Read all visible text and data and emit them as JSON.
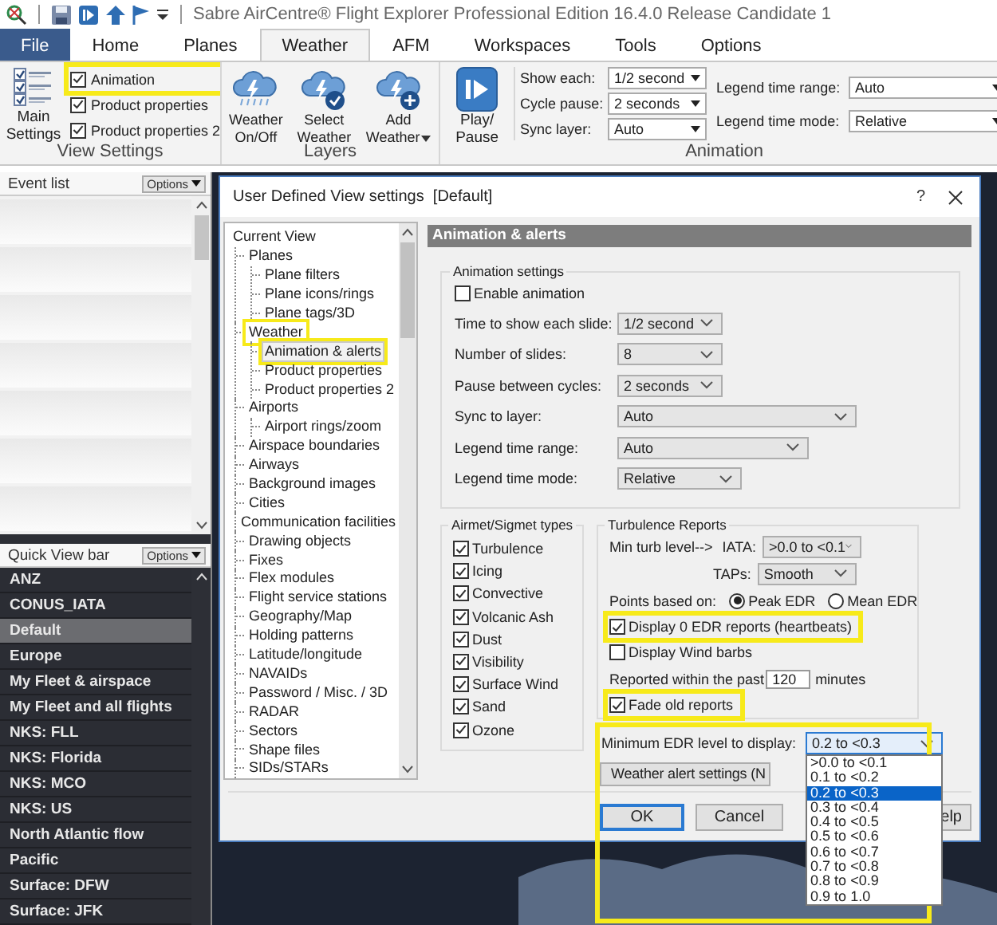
{
  "app": {
    "title": "Sabre AirCentre® Flight Explorer Professional Edition 16.4.0 Release Candidate 1"
  },
  "ribbon_tabs": [
    {
      "label": "File",
      "kind": "file",
      "selected": false
    },
    {
      "label": "Home",
      "kind": "tab",
      "selected": false
    },
    {
      "label": "Planes",
      "kind": "tab",
      "selected": false
    },
    {
      "label": "Weather",
      "kind": "tab",
      "selected": true
    },
    {
      "label": "AFM",
      "kind": "tab",
      "selected": false
    },
    {
      "label": "Workspaces",
      "kind": "tab",
      "selected": false
    },
    {
      "label": "Tools",
      "kind": "tab",
      "selected": false
    },
    {
      "label": "Options",
      "kind": "tab",
      "selected": false
    }
  ],
  "ribbon": {
    "view_settings": {
      "label": "View Settings",
      "main_button": "Main Settings",
      "checkboxes": [
        {
          "label": "Animation",
          "checked": true,
          "highlighted": true
        },
        {
          "label": "Product properties",
          "checked": true,
          "highlighted": false
        },
        {
          "label": "Product properties 2",
          "checked": true,
          "highlighted": false
        }
      ]
    },
    "layers": {
      "label": "Layers",
      "buttons": [
        {
          "label": "Weather On/Off",
          "kind": "toggle"
        },
        {
          "label": "Select Weather",
          "kind": "select"
        },
        {
          "label": "Add Weather",
          "kind": "add"
        }
      ]
    },
    "animation": {
      "label": "Animation",
      "play_button": "Play/ Pause",
      "fields": [
        {
          "label": "Show each:",
          "value": "1/2 second"
        },
        {
          "label": "Cycle pause:",
          "value": "2 seconds"
        },
        {
          "label": "Sync layer:",
          "value": "Auto"
        }
      ],
      "legend_fields": [
        {
          "label": "Legend time range:",
          "value": "Auto"
        },
        {
          "label": "Legend time mode:",
          "value": "Relative"
        }
      ]
    }
  },
  "event_list": {
    "title": "Event list",
    "options": "Options"
  },
  "quick_view": {
    "title": "Quick View bar",
    "options": "Options",
    "items": [
      {
        "label": "ANZ",
        "selected": false
      },
      {
        "label": "CONUS_IATA",
        "selected": false
      },
      {
        "label": "Default",
        "selected": true
      },
      {
        "label": "Europe",
        "selected": false
      },
      {
        "label": "My Fleet & airspace",
        "selected": false
      },
      {
        "label": "My Fleet and all flights",
        "selected": false
      },
      {
        "label": "NKS: FLL",
        "selected": false
      },
      {
        "label": "NKS: Florida",
        "selected": false
      },
      {
        "label": "NKS: MCO",
        "selected": false
      },
      {
        "label": "NKS: US",
        "selected": false
      },
      {
        "label": "North Atlantic flow",
        "selected": false
      },
      {
        "label": "Pacific",
        "selected": false
      },
      {
        "label": "Surface: DFW",
        "selected": false
      },
      {
        "label": "Surface: JFK",
        "selected": false
      }
    ]
  },
  "dialog": {
    "title": "User Defined View settings  [Default]",
    "help": "?",
    "tree": [
      {
        "label": "Current View",
        "selected": false,
        "highlighted": false,
        "children": [
          {
            "label": "Planes",
            "selected": false,
            "highlighted": false,
            "children": [
              {
                "label": "Plane filters",
                "selected": false,
                "highlighted": false
              },
              {
                "label": "Plane icons/rings",
                "selected": false,
                "highlighted": false
              },
              {
                "label": "Plane tags/3D",
                "selected": false,
                "highlighted": false
              }
            ]
          },
          {
            "label": "Weather",
            "selected": false,
            "highlighted": true,
            "children": [
              {
                "label": "Animation & alerts",
                "selected": true,
                "highlighted": true
              },
              {
                "label": "Product properties",
                "selected": false,
                "highlighted": false
              },
              {
                "label": "Product properties 2",
                "selected": false,
                "highlighted": false
              }
            ]
          },
          {
            "label": "Airports",
            "selected": false,
            "highlighted": false,
            "children": [
              {
                "label": "Airport rings/zoom",
                "selected": false,
                "highlighted": false
              }
            ]
          },
          {
            "label": "Airspace boundaries",
            "selected": false,
            "highlighted": false
          },
          {
            "label": "Airways",
            "selected": false,
            "highlighted": false
          },
          {
            "label": "Background images",
            "selected": false,
            "highlighted": false
          },
          {
            "label": "Cities",
            "selected": false,
            "highlighted": false
          },
          {
            "label": "Communication facilities",
            "selected": false,
            "highlighted": false
          },
          {
            "label": "Drawing objects",
            "selected": false,
            "highlighted": false
          },
          {
            "label": "Fixes",
            "selected": false,
            "highlighted": false
          },
          {
            "label": "Flex modules",
            "selected": false,
            "highlighted": false
          },
          {
            "label": "Flight service stations",
            "selected": false,
            "highlighted": false
          },
          {
            "label": "Geography/Map",
            "selected": false,
            "highlighted": false
          },
          {
            "label": "Holding patterns",
            "selected": false,
            "highlighted": false
          },
          {
            "label": "Latitude/longitude",
            "selected": false,
            "highlighted": false
          },
          {
            "label": "NAVAIDs",
            "selected": false,
            "highlighted": false
          },
          {
            "label": "Password / Misc. / 3D",
            "selected": false,
            "highlighted": false
          },
          {
            "label": "RADAR",
            "selected": false,
            "highlighted": false
          },
          {
            "label": "Sectors",
            "selected": false,
            "highlighted": false
          },
          {
            "label": "Shape files",
            "selected": false,
            "highlighted": false
          },
          {
            "label": "SIDs/STARs",
            "selected": false,
            "highlighted": false
          }
        ]
      }
    ],
    "section_title": "Animation & alerts",
    "animation_settings": {
      "legend": "Animation settings",
      "enable": {
        "label": "Enable animation",
        "checked": false
      },
      "fields": [
        {
          "label": "Time to show each slide:",
          "value": "1/2 second"
        },
        {
          "label": "Number of slides:",
          "value": "8"
        },
        {
          "label": "Pause between cycles:",
          "value": "2 seconds"
        },
        {
          "label": "Sync to layer:",
          "value": "Auto"
        },
        {
          "label": "Legend time range:",
          "value": "Auto"
        },
        {
          "label": "Legend time mode:",
          "value": "Relative"
        }
      ]
    },
    "airmet": {
      "legend": "Airmet/Sigmet types",
      "items": [
        {
          "label": "Turbulence",
          "checked": true
        },
        {
          "label": "Icing",
          "checked": true
        },
        {
          "label": "Convective",
          "checked": true
        },
        {
          "label": "Volcanic Ash",
          "checked": true
        },
        {
          "label": "Dust",
          "checked": true
        },
        {
          "label": "Visibility",
          "checked": true
        },
        {
          "label": "Surface Wind",
          "checked": true
        },
        {
          "label": "Sand",
          "checked": true
        },
        {
          "label": "Ozone",
          "checked": true
        }
      ]
    },
    "turbulence": {
      "legend": "Turbulence Reports",
      "min_label": "Min turb level-->",
      "iata_label": "IATA:",
      "iata_value": ">0.0 to <0.1",
      "taps_label": "TAPs:",
      "taps_value": "Smooth",
      "points_label": "Points based on:",
      "points_options": [
        {
          "label": "Peak EDR",
          "selected": true
        },
        {
          "label": "Mean EDR",
          "selected": false
        }
      ],
      "checks": [
        {
          "label": "Display 0 EDR reports (heartbeats)",
          "checked": true,
          "highlighted": true
        },
        {
          "label": "Display Wind barbs",
          "checked": false,
          "highlighted": false
        }
      ],
      "reported_label": "Reported within the past",
      "reported_value": "120",
      "reported_unit": "minutes",
      "fade": {
        "label": "Fade old reports",
        "checked": true,
        "highlighted": true
      }
    },
    "edr": {
      "label": "Minimum EDR level to display:",
      "value": "0.2 to <0.3",
      "expanded": true,
      "highlighted": true,
      "options": [
        {
          "label": ">0.0 to <0.1",
          "selected": false
        },
        {
          "label": "0.1 to <0.2",
          "selected": false
        },
        {
          "label": "0.2 to <0.3",
          "selected": true
        },
        {
          "label": "0.3 to <0.4",
          "selected": false
        },
        {
          "label": "0.4 to <0.5",
          "selected": false
        },
        {
          "label": "0.5 to <0.6",
          "selected": false
        },
        {
          "label": "0.6 to <0.7",
          "selected": false
        },
        {
          "label": "0.7 to <0.8",
          "selected": false
        },
        {
          "label": "0.8 to <0.9",
          "selected": false
        },
        {
          "label": "0.9 to 1.0",
          "selected": false
        }
      ]
    },
    "alert_button": "Weather alert settings (N",
    "buttons": [
      {
        "label": "OK",
        "kind": "default"
      },
      {
        "label": "Cancel",
        "kind": "normal"
      },
      {
        "label": "elp",
        "kind": "partial"
      }
    ]
  }
}
